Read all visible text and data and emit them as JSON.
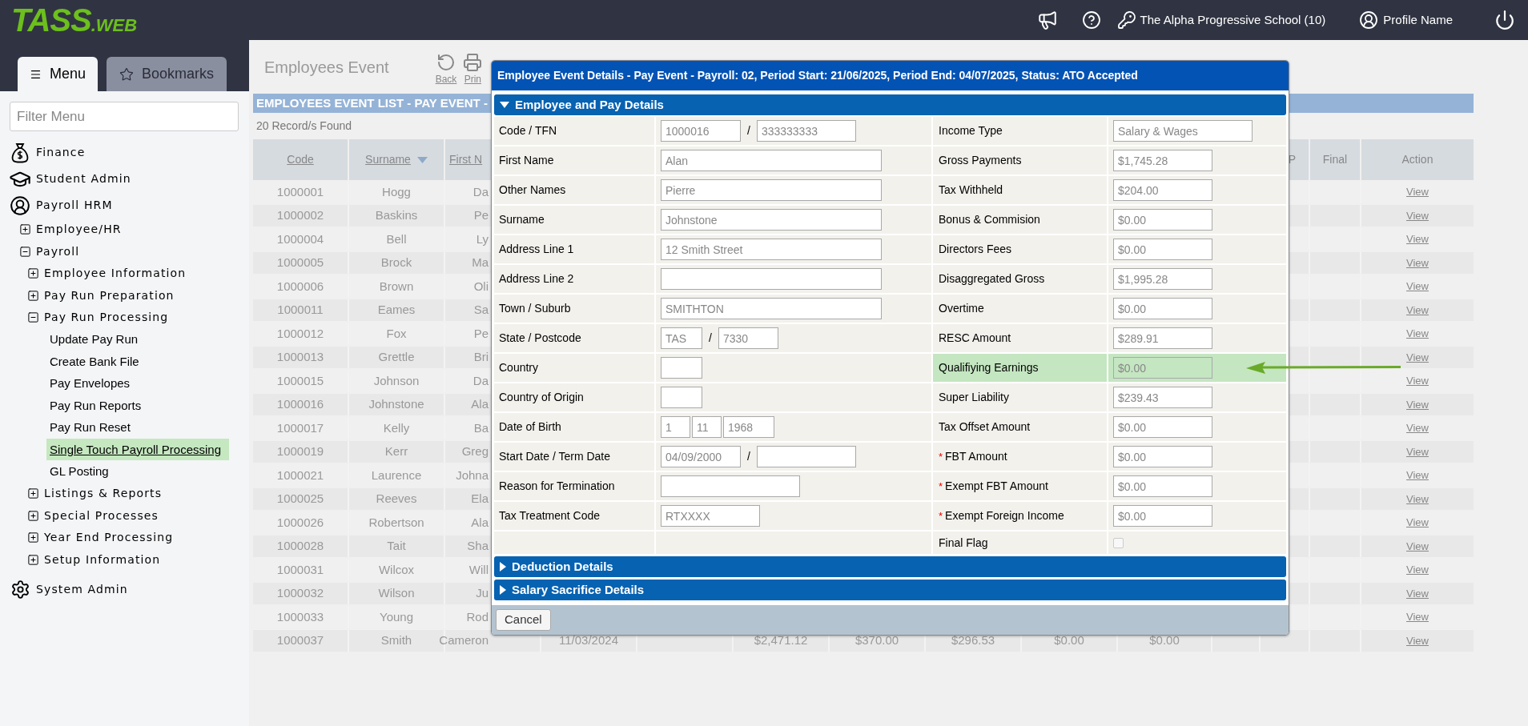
{
  "topbar": {
    "logo": {
      "main": "TASS",
      "suffix": ".WEB"
    },
    "school": "The Alpha Progressive School (10)",
    "profile": "Profile Name"
  },
  "sidebar": {
    "tabs": [
      {
        "label": "Menu",
        "selected": true
      },
      {
        "label": "Bookmarks",
        "selected": false
      }
    ],
    "filter": {
      "placeholder": "Filter Menu"
    },
    "tree": [
      {
        "label": "Finance"
      },
      {
        "label": "Student Admin"
      },
      {
        "label": "Payroll HRM",
        "children": [
          {
            "label": "Employee/HR",
            "expanded": false
          },
          {
            "label": "Payroll",
            "expanded": true,
            "children": [
              {
                "label": "Employee Information",
                "expanded": false
              },
              {
                "label": "Pay Run Preparation",
                "expanded": false
              },
              {
                "label": "Pay Run Processing",
                "expanded": true,
                "children": [
                  {
                    "label": "Update Pay Run",
                    "selected": false
                  },
                  {
                    "label": "Create Bank File",
                    "selected": false
                  },
                  {
                    "label": "Pay Envelopes",
                    "selected": false
                  },
                  {
                    "label": "Pay Run Reports",
                    "selected": false
                  },
                  {
                    "label": "Pay Run Reset",
                    "selected": false
                  },
                  {
                    "label": "Single Touch Payroll Processing",
                    "selected": true
                  },
                  {
                    "label": "GL Posting",
                    "selected": false
                  }
                ]
              },
              {
                "label": "Listings & Reports",
                "expanded": false
              },
              {
                "label": "Special Processes",
                "expanded": false
              },
              {
                "label": "Year End Processing",
                "expanded": false
              },
              {
                "label": "Setup Information",
                "expanded": false
              }
            ]
          }
        ]
      },
      {
        "label": "System Admin"
      }
    ]
  },
  "page": {
    "title": "Employees Event",
    "actions": [
      "Back",
      "Prin"
    ],
    "list_title": "EMPLOYEES EVENT LIST - PAY EVENT -",
    "record_count": "20 Record/s Found"
  },
  "table": {
    "columns": [
      {
        "label": "Code",
        "kind": "link",
        "sorted": false
      },
      {
        "label": "Surname",
        "kind": "link",
        "sorted": true
      },
      {
        "label": "First N",
        "kind": "link",
        "sorted": false
      },
      null,
      null,
      null,
      null,
      null,
      null,
      null,
      null,
      {
        "label": "P",
        "kind": "plain",
        "sorted": false
      },
      {
        "label": "Final",
        "kind": "plain",
        "sorted": false
      },
      {
        "label": "Action",
        "kind": "action",
        "sorted": false
      }
    ],
    "rows": [
      {
        "cells": [
          "1000001",
          "Hogg",
          "Da",
          null,
          null,
          null,
          null,
          null,
          null,
          null,
          null,
          null,
          null,
          "View"
        ]
      },
      {
        "cells": [
          "1000002",
          "Baskins",
          "Pe",
          null,
          null,
          null,
          null,
          null,
          null,
          null,
          null,
          null,
          null,
          "View"
        ]
      },
      {
        "cells": [
          "1000004",
          "Bell",
          "Ly",
          null,
          null,
          null,
          null,
          null,
          null,
          null,
          null,
          null,
          null,
          "View"
        ]
      },
      {
        "cells": [
          "1000005",
          "Brock",
          "Ma",
          null,
          null,
          null,
          null,
          null,
          null,
          null,
          null,
          null,
          null,
          "View"
        ]
      },
      {
        "cells": [
          "1000006",
          "Brown",
          "Oli",
          null,
          null,
          null,
          null,
          null,
          null,
          null,
          null,
          null,
          null,
          "View"
        ]
      },
      {
        "cells": [
          "1000011",
          "Eames",
          "Sa",
          null,
          null,
          null,
          null,
          null,
          null,
          null,
          null,
          null,
          null,
          "View"
        ]
      },
      {
        "cells": [
          "1000012",
          "Fox",
          "Pe",
          null,
          null,
          null,
          null,
          null,
          null,
          null,
          null,
          null,
          null,
          "View"
        ]
      },
      {
        "cells": [
          "1000013",
          "Grettle",
          "Bri",
          null,
          null,
          null,
          null,
          null,
          null,
          null,
          null,
          null,
          null,
          "View"
        ]
      },
      {
        "cells": [
          "1000015",
          "Johnson",
          "Da",
          null,
          null,
          null,
          null,
          null,
          null,
          null,
          null,
          null,
          null,
          "View"
        ]
      },
      {
        "cells": [
          "1000016",
          "Johnstone",
          "Ala",
          null,
          null,
          null,
          null,
          null,
          null,
          null,
          null,
          null,
          null,
          "View"
        ]
      },
      {
        "cells": [
          "1000017",
          "Kelly",
          "Ba",
          null,
          null,
          null,
          null,
          null,
          null,
          null,
          null,
          null,
          null,
          "View"
        ]
      },
      {
        "cells": [
          "1000019",
          "Kerr",
          "Greg",
          null,
          null,
          null,
          null,
          null,
          null,
          null,
          null,
          null,
          null,
          "View"
        ]
      },
      {
        "cells": [
          "1000021",
          "Laurence",
          "Johna",
          null,
          null,
          null,
          null,
          null,
          null,
          null,
          null,
          null,
          null,
          "View"
        ]
      },
      {
        "cells": [
          "1000025",
          "Reeves",
          "Ela",
          null,
          null,
          null,
          null,
          null,
          null,
          null,
          null,
          null,
          null,
          "View"
        ]
      },
      {
        "cells": [
          "1000026",
          "Robertson",
          "Ala",
          null,
          null,
          null,
          null,
          null,
          null,
          null,
          null,
          null,
          null,
          "View"
        ]
      },
      {
        "cells": [
          "1000028",
          "Tait",
          "Sha",
          null,
          null,
          null,
          null,
          null,
          null,
          null,
          null,
          null,
          null,
          "View"
        ]
      },
      {
        "cells": [
          "1000031",
          "Wilcox",
          "Will",
          null,
          null,
          null,
          null,
          null,
          null,
          null,
          null,
          null,
          null,
          "View"
        ]
      },
      {
        "cells": [
          "1000032",
          "Wilson",
          "Ju",
          null,
          null,
          null,
          null,
          null,
          null,
          null,
          null,
          null,
          null,
          "View"
        ]
      },
      {
        "cells": [
          "1000033",
          "Young",
          "Rod",
          null,
          null,
          null,
          null,
          null,
          null,
          null,
          null,
          null,
          null,
          "View"
        ]
      },
      {
        "cells": [
          "1000037",
          "Smith",
          "Cameron",
          "11/03/2024",
          null,
          "$2,471.12",
          "$370.00",
          "$296.53",
          "$0.00",
          "$0.00",
          null,
          null,
          null,
          "View"
        ]
      }
    ]
  },
  "dialog": {
    "title": "Employee Event Details - Pay Event - Payroll: 02, Period Start: 21/06/2025, Period End: 04/07/2025, Status: ATO Accepted",
    "sections": [
      {
        "title": "Employee and Pay Details",
        "expanded": true,
        "left_fields": [
          {
            "label": "Code / TFN",
            "parts": [
              {
                "kind": "input",
                "value": "1000016"
              },
              {
                "kind": "separator",
                "text": "/"
              },
              {
                "kind": "input",
                "value": "333333333"
              }
            ]
          },
          {
            "label": "First Name",
            "parts": [
              {
                "kind": "input",
                "value": "Alan"
              }
            ]
          },
          {
            "label": "Other Names",
            "parts": [
              {
                "kind": "input",
                "value": "Pierre"
              }
            ]
          },
          {
            "label": "Surname",
            "parts": [
              {
                "kind": "input",
                "value": "Johnstone"
              }
            ]
          },
          {
            "label": "Address Line 1",
            "parts": [
              {
                "kind": "input",
                "value": "12 Smith Street"
              }
            ]
          },
          {
            "label": "Address Line 2",
            "parts": [
              {
                "kind": "input"
              }
            ]
          },
          {
            "label": "Town / Suburb",
            "parts": [
              {
                "kind": "input",
                "value": "SMITHTON"
              }
            ]
          },
          {
            "label": "State / Postcode",
            "parts": [
              {
                "kind": "input",
                "value": "TAS"
              },
              {
                "kind": "separator",
                "text": "/"
              },
              {
                "kind": "input",
                "value": "7330"
              }
            ]
          },
          {
            "label": "Country",
            "parts": [
              {
                "kind": "input"
              }
            ]
          },
          {
            "label": "Country of Origin",
            "parts": [
              {
                "kind": "input"
              }
            ]
          },
          {
            "label": "Date of Birth",
            "parts": [
              {
                "kind": "input",
                "value": "1"
              },
              {
                "kind": "input",
                "value": "11"
              },
              {
                "kind": "input",
                "value": "1968"
              }
            ]
          },
          {
            "label": "Start Date / Term Date",
            "parts": [
              {
                "kind": "input",
                "value": "04/09/2000"
              },
              {
                "kind": "separator",
                "text": "/"
              },
              {
                "kind": "input"
              }
            ]
          },
          {
            "label": "Reason for Termination",
            "parts": [
              {
                "kind": "input"
              }
            ]
          },
          {
            "label": "Tax Treatment Code",
            "parts": [
              {
                "kind": "input",
                "value": "RTXXXX"
              }
            ]
          }
        ],
        "right_fields": [
          {
            "label": "Income Type",
            "kind": "input",
            "value": "Salary & Wages",
            "highlighted": false
          },
          {
            "label": "Gross Payments",
            "kind": "input",
            "value": "$1,745.28",
            "highlighted": false
          },
          {
            "label": "Tax Withheld",
            "kind": "input",
            "value": "$204.00",
            "highlighted": false
          },
          {
            "label": "Bonus & Commision",
            "kind": "input",
            "value": "$0.00",
            "highlighted": false
          },
          {
            "label": "Directors Fees",
            "kind": "input",
            "value": "$0.00",
            "highlighted": false
          },
          {
            "label": "Disaggregated Gross",
            "kind": "input",
            "value": "$1,995.28",
            "highlighted": false
          },
          {
            "label": "Overtime",
            "kind": "input",
            "value": "$0.00",
            "highlighted": false
          },
          {
            "label": "RESC Amount",
            "kind": "input",
            "value": "$289.91",
            "highlighted": false
          },
          {
            "label": "Qualifiying Earnings",
            "kind": "input",
            "value": "$0.00",
            "highlighted": true
          },
          {
            "label": "Super Liability",
            "kind": "input",
            "value": "$239.43",
            "highlighted": false
          },
          {
            "label": "Tax Offset Amount",
            "kind": "input",
            "value": "$0.00",
            "highlighted": false
          },
          {
            "label": "FBT Amount",
            "required_mark": "*",
            "kind": "input",
            "value": "$0.00",
            "highlighted": false
          },
          {
            "label": "Exempt FBT Amount",
            "required_mark": "*",
            "kind": "input",
            "value": "$0.00",
            "highlighted": false
          },
          {
            "label": "Exempt Foreign Income",
            "required_mark": "*",
            "kind": "input",
            "value": "$0.00",
            "highlighted": false
          },
          {
            "label": "Final Flag",
            "kind": "checkbox",
            "checked": false,
            "highlighted": false
          }
        ]
      },
      {
        "title": "Deduction Details",
        "expanded": false
      },
      {
        "title": "Salary Sacrifice Details",
        "expanded": false
      }
    ],
    "buttons": [
      "Cancel"
    ]
  }
}
